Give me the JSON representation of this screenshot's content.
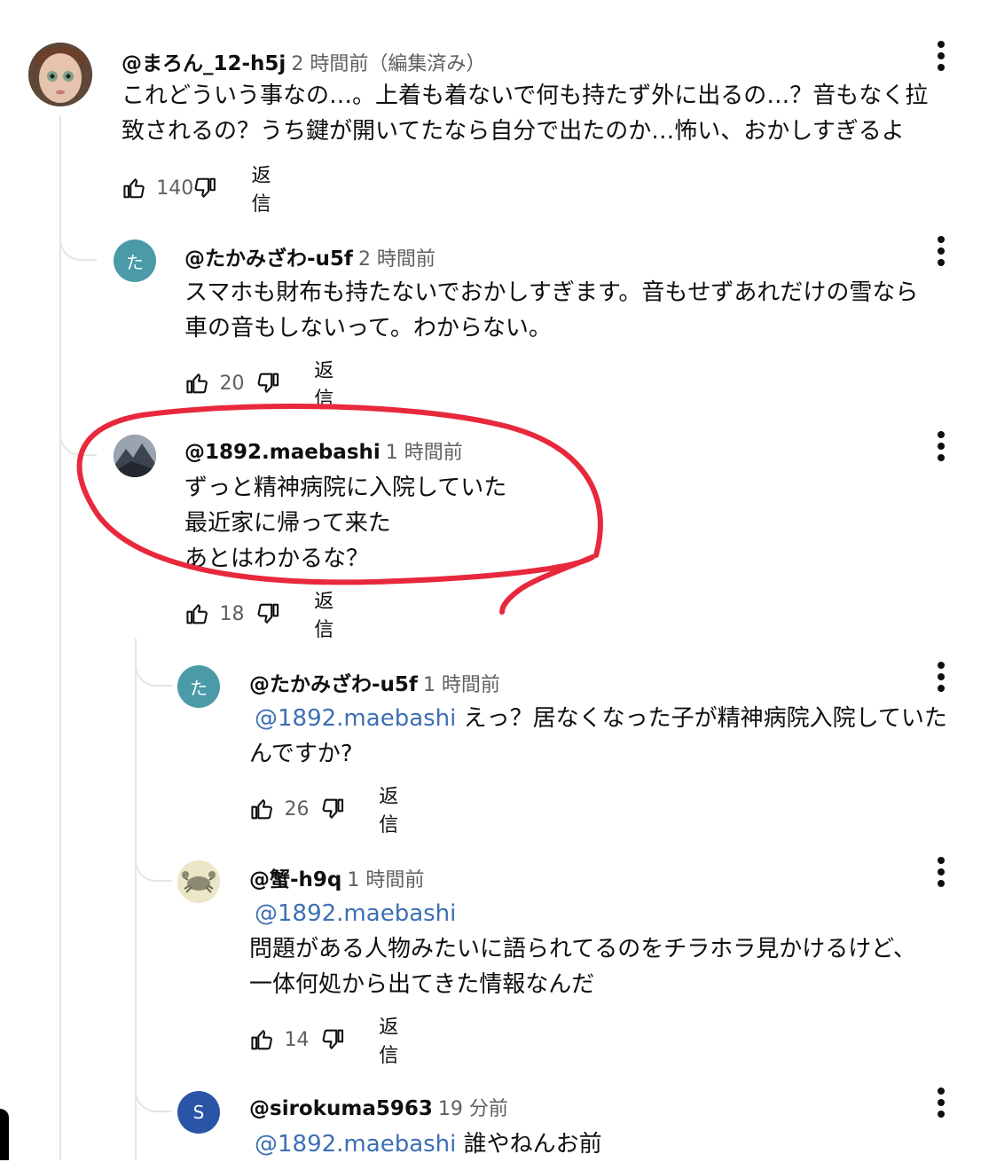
{
  "comments": [
    {
      "author": "@まろん_12-h5j",
      "time": "2 時間前（編集済み）",
      "lines": [
        "これどういう事なの…。上着も着ないで何も持たず外に出るの…？音もなく拉",
        "致されるの？うち鍵が開いてたなら自分で出たのか…怖い、おかしすぎるよ"
      ],
      "likes": "140",
      "reply": "返信",
      "avatar": {
        "type": "photo",
        "icon": "doll-avatar-icon",
        "color": "#8a6a5a"
      }
    },
    {
      "author": "@たかみざわ-u5f",
      "time": "2 時間前",
      "lines": [
        "スマホも財布も持たないでおかしすぎます。音もせずあれだけの雪なら",
        "車の音もしないって。わからない。"
      ],
      "likes": "20",
      "reply": "返信",
      "avatar": {
        "type": "letter",
        "letter": "た",
        "color": "#4a9aa8"
      }
    },
    {
      "author": "@1892.maebashi",
      "time": "1 時間前",
      "lines": [
        "ずっと精神病院に入院していた",
        "最近家に帰って来た",
        "あとはわかるな？"
      ],
      "likes": "18",
      "reply": "返信",
      "avatar": {
        "type": "photo",
        "icon": "mountain-avatar-icon",
        "color": "#5a6070"
      }
    },
    {
      "author": "@たかみざわ-u5f",
      "time": "1 時間前",
      "mention": "@1892.maebashi",
      "lines": [
        " えっ？居なくなった子が精神病院入院していた",
        "んですか?"
      ],
      "likes": "26",
      "reply": "返信",
      "avatar": {
        "type": "letter",
        "letter": "た",
        "color": "#4a9aa8"
      }
    },
    {
      "author": "@蟹-h9q",
      "time": "1 時間前",
      "mention": "@1892.maebashi",
      "lines": [
        "",
        "問題がある人物みたいに語られてるのをチラホラ見かけるけど、",
        "一体何処から出てきた情報なんだ"
      ],
      "likes": "14",
      "reply": "返信",
      "avatar": {
        "type": "photo",
        "icon": "crab-avatar-icon",
        "color": "#d9d2b4"
      }
    },
    {
      "author": "@sirokuma5963",
      "time": "19 分前",
      "mention": "@1892.maebashi",
      "lines": [
        "  誰やねんお前"
      ],
      "avatar": {
        "type": "letter",
        "letter": "S",
        "color": "#2a55a6"
      }
    }
  ],
  "colors": {
    "highlight_circle": "#e8283c",
    "mention": "#3c6fb4",
    "letter_avatar_teal": "#4a9aa8",
    "letter_avatar_blue": "#2a55a6"
  }
}
